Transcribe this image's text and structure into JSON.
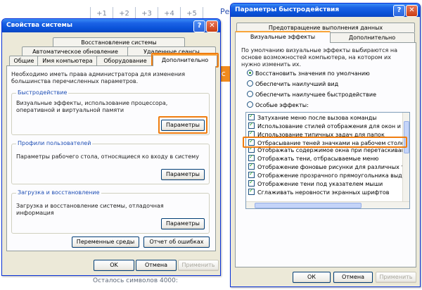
{
  "background": {
    "grid": [
      "+1",
      "+2",
      "+3",
      "+4",
      "+5"
    ],
    "link_text": "Ре",
    "orange_text": "ac",
    "footer_text": "Осталось символов      4000:"
  },
  "system_properties": {
    "title": "Свойства системы",
    "help_glyph": "?",
    "close_glyph": "✕",
    "tabs_row1": [
      "Восстановление системы"
    ],
    "tabs_row2": [
      "Автоматическое обновление",
      "Удаленные сеансы"
    ],
    "tabs_row3": [
      "Общие",
      "Имя компьютера",
      "Оборудование",
      "Дополнительно"
    ],
    "active_tab": "Дополнительно",
    "admin_note": "Необходимо иметь права администратора для изменения большинства перечисленных параметров.",
    "performance": {
      "title": "Быстродействие",
      "text": "Визуальные эффекты, использование процессора, оперативной и виртуальной памяти",
      "button": "Параметры"
    },
    "user_profiles": {
      "title": "Профили пользователей",
      "text": "Параметры рабочего стола, относящиеся ко входу в систему",
      "button": "Параметры"
    },
    "startup_recovery": {
      "title": "Загрузка и восстановление",
      "text": "Загрузка и восстановление системы, отладочная информация",
      "button": "Параметры"
    },
    "env_button": "Переменные среды",
    "error_button": "Отчет об ошибках",
    "ok": "OK",
    "cancel": "Отмена",
    "apply": "Применить"
  },
  "performance_options": {
    "title": "Параметры быстродействия",
    "help_glyph": "?",
    "close_glyph": "✕",
    "tab_dep": "Предотвращение выполнения данных",
    "tab_visual": "Визуальные эффекты",
    "tab_advanced": "Дополнительно",
    "description": "По умолчанию визуальные эффекты выбираются на основе возможностей компьютера, на котором их нужно изменить их.",
    "radios": [
      {
        "label": "Восстановить значения по умолчанию",
        "selected": true
      },
      {
        "label": "Обеспечить наилучший вид",
        "selected": false
      },
      {
        "label": "Обеспечить наилучшее быстродействие",
        "selected": false
      },
      {
        "label": "Особые эффекты:",
        "selected": false
      }
    ],
    "effects": [
      {
        "label": "Затухание меню после вызова команды",
        "checked": true
      },
      {
        "label": "Использование стилей отображения для окон и кнопок",
        "checked": true
      },
      {
        "label": "Использование типичных задач для папок",
        "checked": true
      },
      {
        "label": "Отбрасывание теней значками на рабочем столе",
        "checked": true
      },
      {
        "label": "Отображать содержимое окна при перетаскивании",
        "checked": true
      },
      {
        "label": "Отображать тени, отбрасываемые меню",
        "checked": true
      },
      {
        "label": "Отображение фоновые рисунки для различных типов па",
        "checked": true
      },
      {
        "label": "Отображение прозрачного прямоугольника выделения",
        "checked": true
      },
      {
        "label": "Отображение тени под указателем мыши",
        "checked": true
      },
      {
        "label": "Сглаживать неровности экранных шрифтов",
        "checked": true
      }
    ],
    "highlighted_effect": "Отбрасывание теней значками на рабочем столе",
    "ok": "ОК",
    "cancel": "Отмена",
    "apply": "Применить"
  }
}
